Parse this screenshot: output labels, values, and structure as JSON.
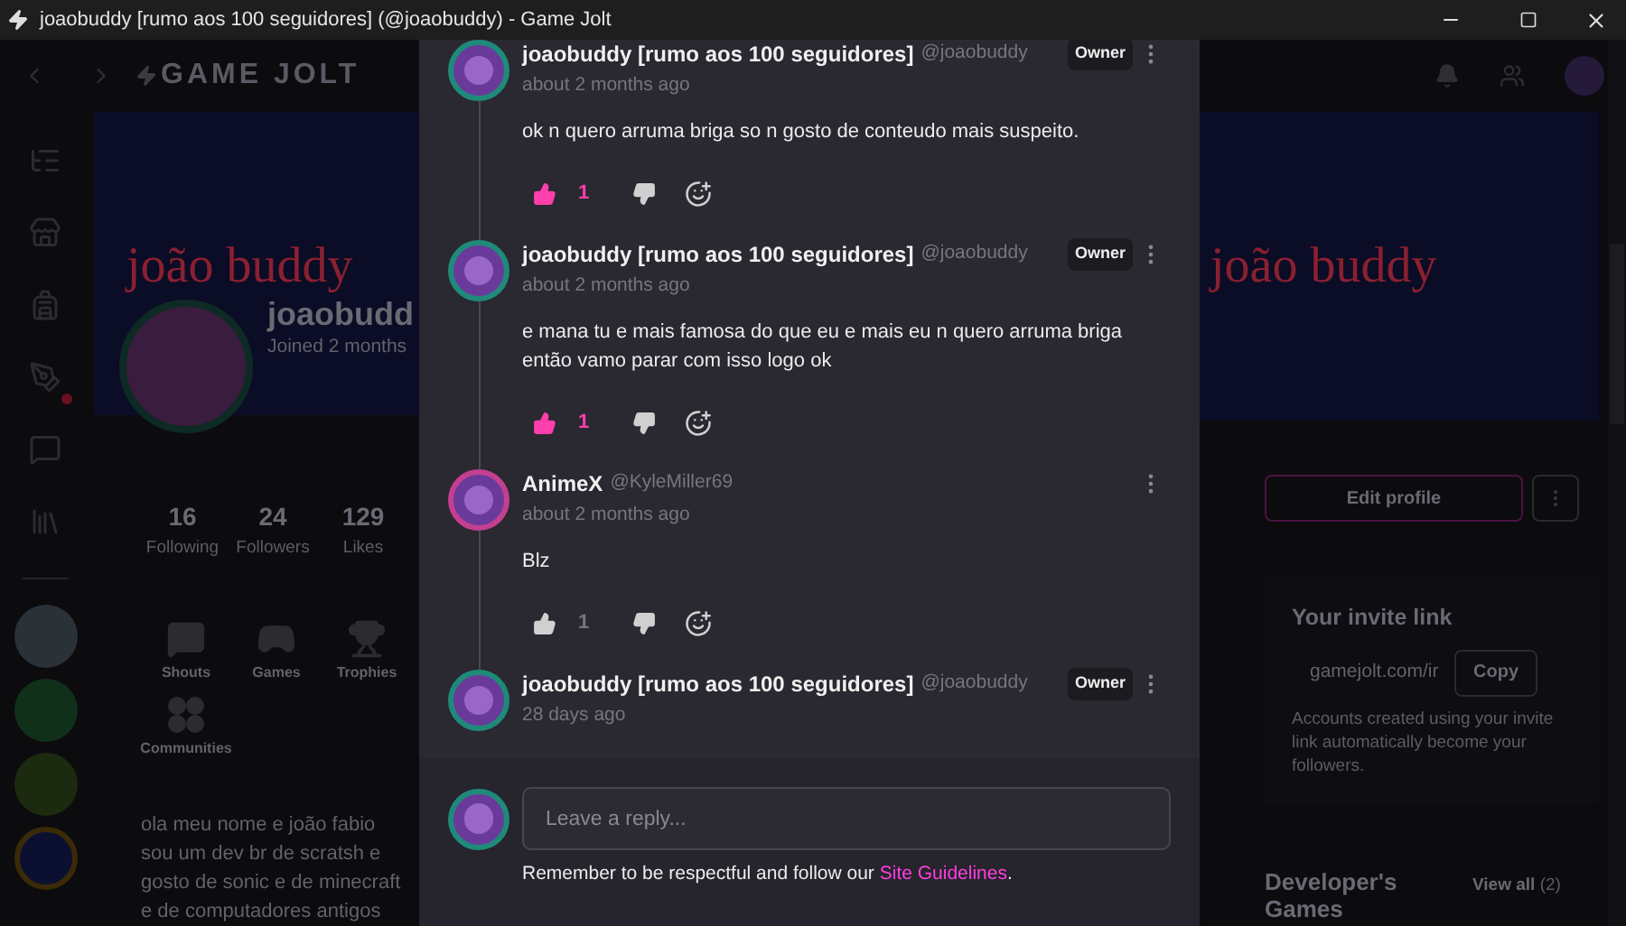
{
  "window": {
    "title": "joaobuddy [rumo aos 100 seguidores] (@joaobuddy) - Game Jolt"
  },
  "app": {
    "logo": "GAME JOLT",
    "banner_text_left": "joão buddy",
    "banner_text_right": "joão buddy",
    "profile": {
      "name": "joaobudd",
      "joined": "Joined 2 months"
    },
    "stats": [
      {
        "value": "16",
        "label": "Following"
      },
      {
        "value": "24",
        "label": "Followers"
      },
      {
        "value": "129",
        "label": "Likes"
      }
    ],
    "sections": [
      {
        "label": "Shouts",
        "kind": "shouts"
      },
      {
        "label": "Games",
        "kind": "games"
      },
      {
        "label": "Trophies",
        "kind": "trophies"
      },
      {
        "label": "Communities",
        "kind": "communities"
      }
    ],
    "bio": "ola meu nome e joão fabio sou um dev br de scratsh e gosto de sonic e de minecraft e de computadores antigos",
    "edit_button": "Edit profile",
    "invite": {
      "title": "Your invite link",
      "link": "gamejolt.com/ir",
      "copy": "Copy",
      "note": "Accounts created using your invite link automatically become your followers."
    },
    "games": {
      "title": "Developer's Games",
      "view_all": "View all",
      "count": "(2)"
    }
  },
  "comments": [
    {
      "name": "joaobuddy [rumo aos 100 seguidores]",
      "handle": "@joaobuddy",
      "badge": "Owner",
      "time": "about 2 months ago",
      "text": "ok n quero arruma briga so n gosto de conteudo mais suspeito.",
      "likes": "1",
      "liked": true,
      "color": "#1f8a7a"
    },
    {
      "name": "joaobuddy [rumo aos 100 seguidores]",
      "handle": "@joaobuddy",
      "badge": "Owner",
      "time": "about 2 months ago",
      "text": "e mana tu e mais famosa do que eu e mais eu n quero arruma briga então vamo parar com isso logo ok",
      "likes": "1",
      "liked": true,
      "color": "#1f8a7a"
    },
    {
      "name": "AnimeX",
      "handle": "@KyleMiller69",
      "time": "about 2 months ago",
      "text": "Blz",
      "likes": "1",
      "liked": false,
      "color": "#c2408f"
    },
    {
      "name": "joaobuddy [rumo aos 100 seguidores]",
      "handle": "@joaobuddy",
      "badge": "Owner",
      "time": "28 days ago",
      "color": "#1f8a7a"
    }
  ],
  "reply": {
    "placeholder": "Leave a reply...",
    "note": "Remember to be respectful and follow our",
    "link": "Site Guidelines",
    "end": "."
  }
}
